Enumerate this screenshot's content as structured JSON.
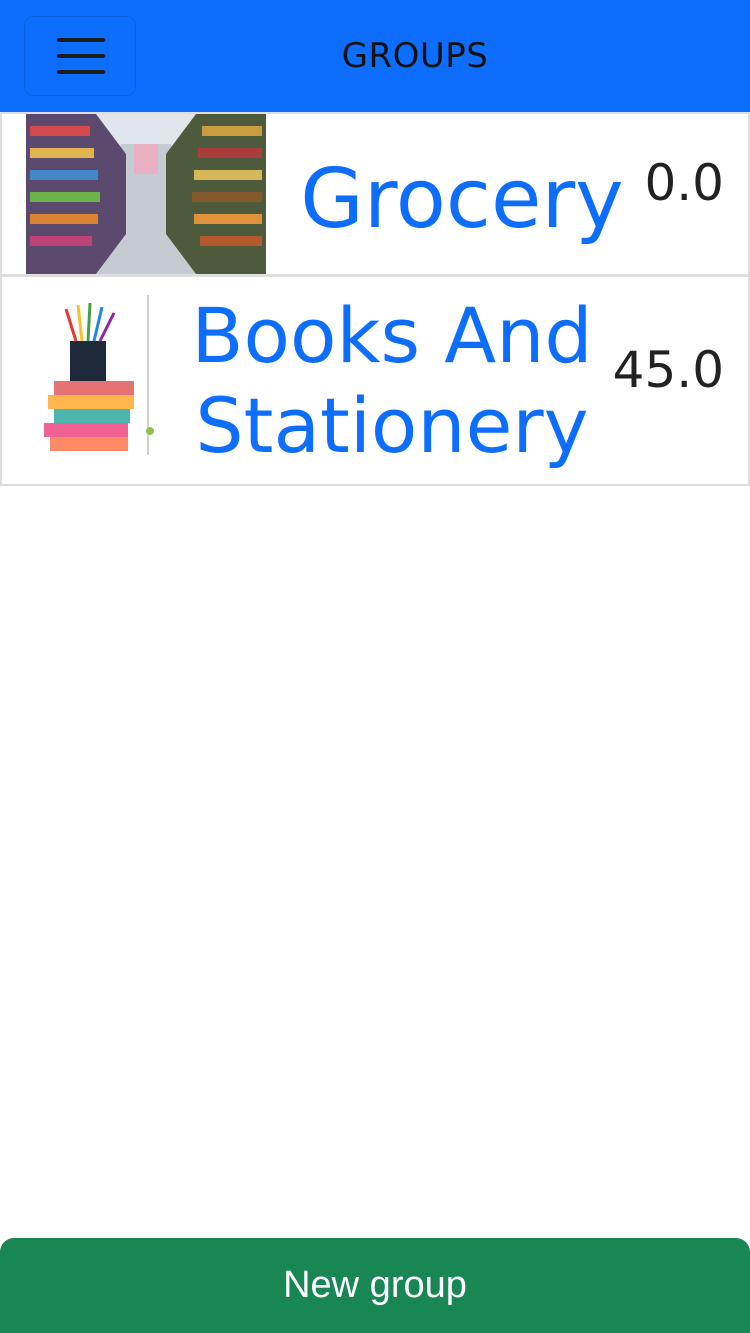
{
  "header": {
    "title": "GROUPS",
    "menu_icon": "hamburger-icon",
    "background": "#0d6efd"
  },
  "groups": [
    {
      "name": "Grocery",
      "amount": "0.0",
      "image": "supermarket-aisle-photo"
    },
    {
      "name": "Books And Stationery",
      "amount": "45.0",
      "image": "books-and-pencils-photo"
    }
  ],
  "footer": {
    "button_label": "New group",
    "button_color": "#198754"
  },
  "accent": "#0d6efd"
}
